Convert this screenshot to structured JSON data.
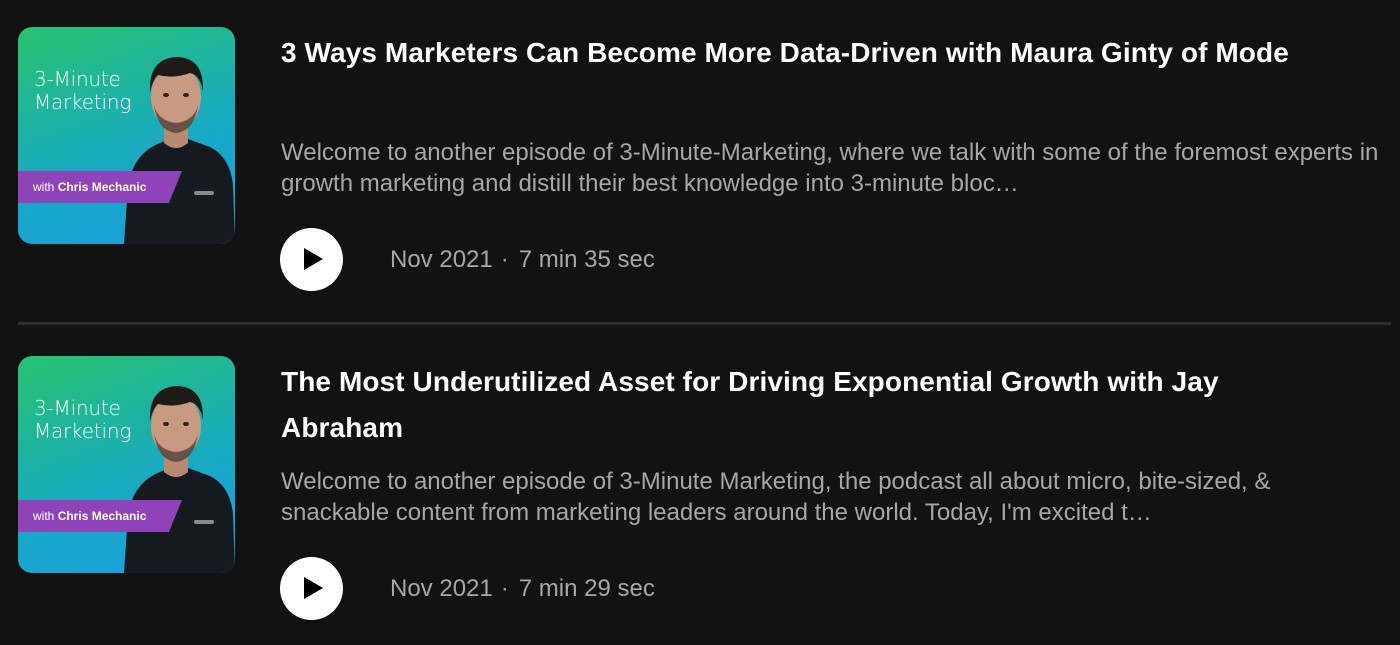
{
  "episodes": [
    {
      "cover": {
        "title_line1": "3-Minute",
        "title_line2": "Marketing",
        "host_prefix": "with",
        "host_name": "Chris Mechanic"
      },
      "title": "3 Ways Marketers Can Become More Data-Driven with Maura Ginty of Mode",
      "description": "Welcome to another episode of 3-Minute-Marketing, where we talk with some of the foremost experts in growth marketing and distill their best knowledge into 3-minute bloc…",
      "date": "Nov 2021",
      "separator": "·",
      "duration": "7 min 35 sec"
    },
    {
      "cover": {
        "title_line1": "3-Minute",
        "title_line2": "Marketing",
        "host_prefix": "with",
        "host_name": "Chris Mechanic"
      },
      "title": "The Most Underutilized Asset for Driving Exponential Growth with Jay Abraham",
      "description": "Welcome to another episode of 3-Minute Marketing, the podcast all about micro, bite-sized, & snackable content from marketing leaders around the world. Today, I'm excited t…",
      "date": "Nov 2021",
      "separator": "·",
      "duration": "7 min 29 sec"
    }
  ],
  "icons": {
    "play": "play-icon"
  },
  "colors": {
    "background": "#121212",
    "title": "#ffffff",
    "subdued_text": "#a7a7a7",
    "cover_band": "#8e44b8"
  }
}
